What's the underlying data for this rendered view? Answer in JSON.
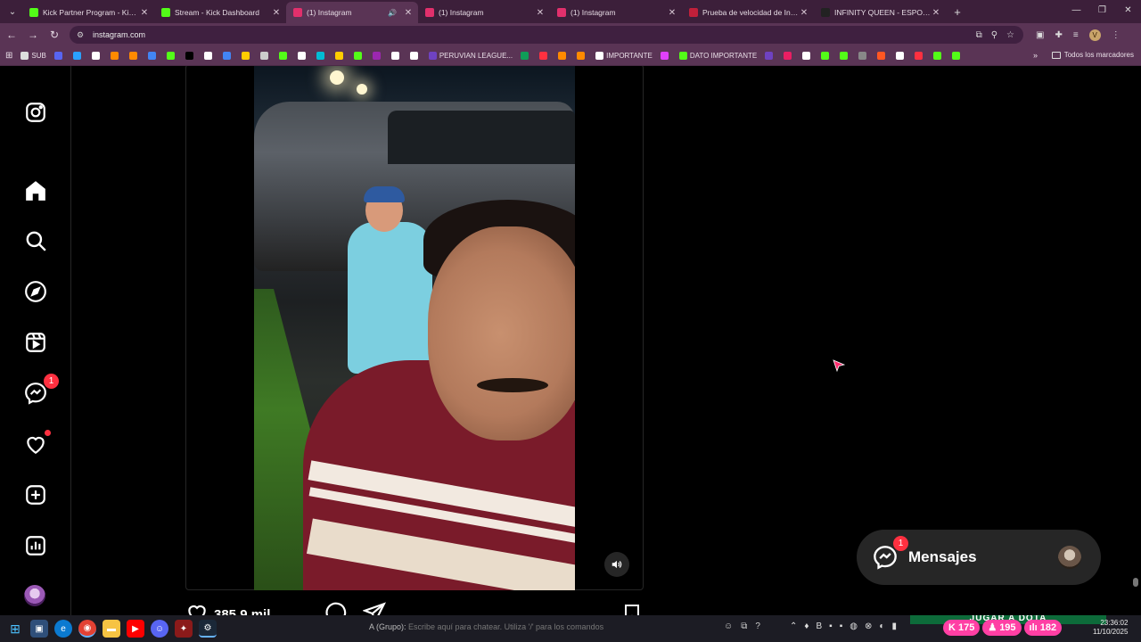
{
  "tabs": [
    {
      "title": "Kick Partner Program - Kick Da",
      "favicon_color": "#53fc18",
      "active": false
    },
    {
      "title": "Stream - Kick Dashboard",
      "favicon_color": "#53fc18",
      "active": false
    },
    {
      "title": "(1) Instagram",
      "favicon_color": "#e1306c",
      "active": true
    },
    {
      "title": "(1) Instagram",
      "favicon_color": "#e1306c",
      "active": false
    },
    {
      "title": "(1) Instagram",
      "favicon_color": "#e1306c",
      "active": false
    },
    {
      "title": "Prueba de velocidad de Interne",
      "favicon_color": "#c0203a",
      "active": false
    },
    {
      "title": "INFINITY QUEEN - ESPORTS FE",
      "favicon_color": "#222222",
      "active": false
    }
  ],
  "address": {
    "url": "instagram.com",
    "profile_initial": "V"
  },
  "bookmarks": {
    "items": [
      {
        "label": "SUB",
        "color": "#dddddd"
      },
      {
        "label": "",
        "color": "#5865f2"
      },
      {
        "label": "",
        "color": "#2aa1ff"
      },
      {
        "label": "",
        "color": "#ffffff"
      },
      {
        "label": "",
        "color": "#ff8a00"
      },
      {
        "label": "",
        "color": "#ff8a00"
      },
      {
        "label": "",
        "color": "#4285f4"
      },
      {
        "label": "",
        "color": "#53fc18"
      },
      {
        "label": "",
        "color": "#000000"
      },
      {
        "label": "",
        "color": "#ffffff"
      },
      {
        "label": "",
        "color": "#4285f4"
      },
      {
        "label": "",
        "color": "#ffcc00"
      },
      {
        "label": "",
        "color": "#cccccc"
      },
      {
        "label": "",
        "color": "#53fc18"
      },
      {
        "label": "",
        "color": "#ffffff"
      },
      {
        "label": "",
        "color": "#00bcd4"
      },
      {
        "label": "",
        "color": "#ffcc00"
      },
      {
        "label": "",
        "color": "#53fc18"
      },
      {
        "label": "",
        "color": "#9c27b0"
      },
      {
        "label": "",
        "color": "#ffffff"
      },
      {
        "label": "",
        "color": "#ffffff"
      },
      {
        "label": "PERUVIAN LEAGUE...",
        "color": "#6f42c1"
      },
      {
        "label": "",
        "color": "#0f9d58"
      },
      {
        "label": "",
        "color": "#ff3040"
      },
      {
        "label": "",
        "color": "#ff8a00"
      },
      {
        "label": "",
        "color": "#ff8a00"
      },
      {
        "label": "IMPORTANTE",
        "color": "#ffffff"
      },
      {
        "label": "",
        "color": "#e040fb"
      },
      {
        "label": "DATO IMPORTANTE",
        "color": "#53fc18"
      },
      {
        "label": "",
        "color": "#6f42c1"
      },
      {
        "label": "",
        "color": "#e91e63"
      },
      {
        "label": "",
        "color": "#ffffff"
      },
      {
        "label": "",
        "color": "#53fc18"
      },
      {
        "label": "",
        "color": "#53fc18"
      },
      {
        "label": "",
        "color": "#888888"
      },
      {
        "label": "",
        "color": "#ff5722"
      },
      {
        "label": "",
        "color": "#ffffff"
      },
      {
        "label": "",
        "color": "#ff3040"
      },
      {
        "label": "",
        "color": "#53fc18"
      },
      {
        "label": "",
        "color": "#53fc18"
      }
    ],
    "more": "»",
    "all_label": "Todos los marcadores"
  },
  "sidebar": {
    "messages_badge": "1"
  },
  "post": {
    "likes": "385,9 mil"
  },
  "messages_pill": {
    "label": "Mensajes",
    "badge": "1"
  },
  "taskbar": {
    "chat_group": "A (Grupo):",
    "chat_placeholder": "Escribe aquí para chatear. Utiliza '/' para los comandos",
    "banner": "JUGAR A DOTA",
    "stats": [
      {
        "icon": "K",
        "value": "175"
      },
      {
        "icon": "♟",
        "value": "195"
      },
      {
        "icon": "ılı",
        "value": "182"
      }
    ],
    "time": "23:36:02",
    "date": "11/10/2025"
  },
  "colors": {
    "tab_bar": "#3c1f3a",
    "toolbar": "#5a3455",
    "notification": "#ff3040",
    "stat_pill": "#ff3fa4"
  }
}
